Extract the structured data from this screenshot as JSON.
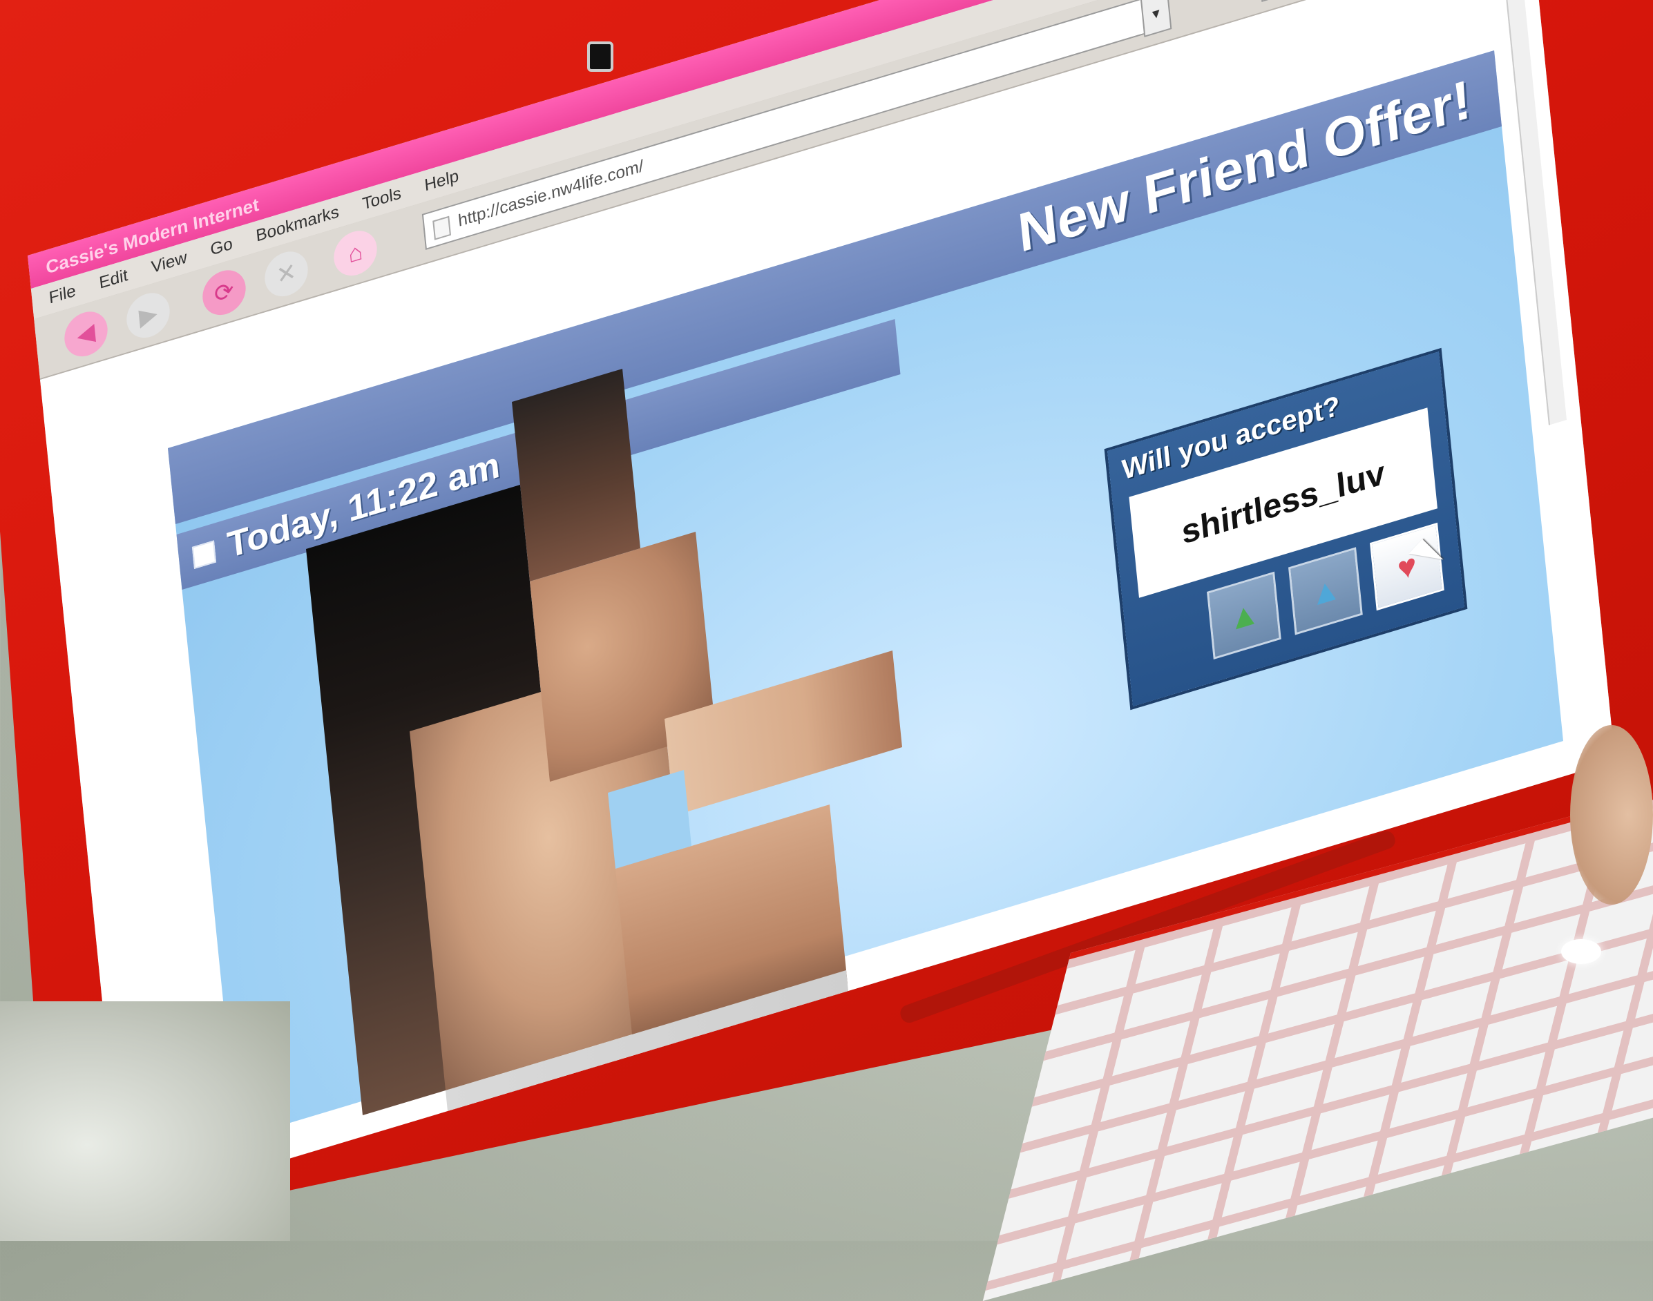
{
  "window": {
    "title": "Cassie's Modern Internet"
  },
  "menu": {
    "items": [
      "File",
      "Edit",
      "View",
      "Go",
      "Bookmarks",
      "Tools",
      "Help"
    ]
  },
  "toolbar": {
    "icons": [
      "back-icon",
      "forward-icon",
      "reload-icon",
      "stop-icon",
      "home-icon"
    ],
    "url": "http://cassie.nw4life.com/",
    "search_placeholder": ""
  },
  "page": {
    "banner_title": "New Friend Offer!",
    "date_text": "Today, 11:22 am",
    "photo_desc": "scrambled tiles",
    "accept_dialog": {
      "title": "Will you accept?",
      "username": "shirtless_luv",
      "buttons": [
        {
          "name": "reject",
          "icon": "green-foot-icon"
        },
        {
          "name": "maybe",
          "icon": "blue-foot-icon"
        },
        {
          "name": "accept",
          "icon": "red-heart-icon"
        }
      ]
    }
  },
  "colors": {
    "bezel": "#e32214",
    "titlebar": "#f0469d",
    "panel": "#a4d4f6",
    "header": "#7c93c6",
    "dialog": "#27538a"
  }
}
